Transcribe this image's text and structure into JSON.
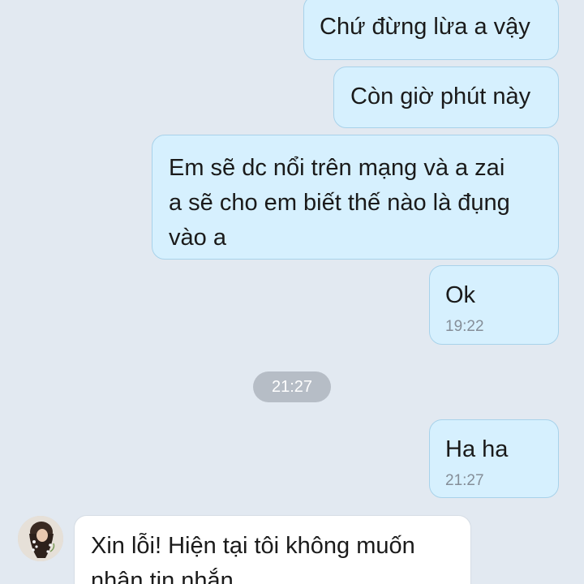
{
  "conversation": {
    "messages": [
      {
        "direction": "outgoing",
        "text": "Chứ đừng lừa a vậy",
        "time": ""
      },
      {
        "direction": "outgoing",
        "text": "Còn giờ phút này",
        "time": ""
      },
      {
        "direction": "outgoing",
        "text": "Em sẽ dc nổi trên mạng và a zai\na sẽ cho em biết thế nào là đụng\nvào a",
        "time": ""
      },
      {
        "direction": "outgoing",
        "text": "Ok",
        "time": "19:22"
      },
      {
        "direction": "outgoing",
        "text": "Ha ha",
        "time": "21:27"
      },
      {
        "direction": "incoming",
        "text": "Xin lỗi! Hiện tại tôi không muốn\nnhận tin nhắn",
        "time": ""
      }
    ],
    "date_divider": "21:27"
  },
  "contact": {
    "avatar_icon": "contact-avatar-photo"
  },
  "colors": {
    "background": "#e2e9f1",
    "outgoing_bubble": "#d6f0fe",
    "incoming_bubble": "#ffffff",
    "time_divider": "#b6bdc6"
  }
}
